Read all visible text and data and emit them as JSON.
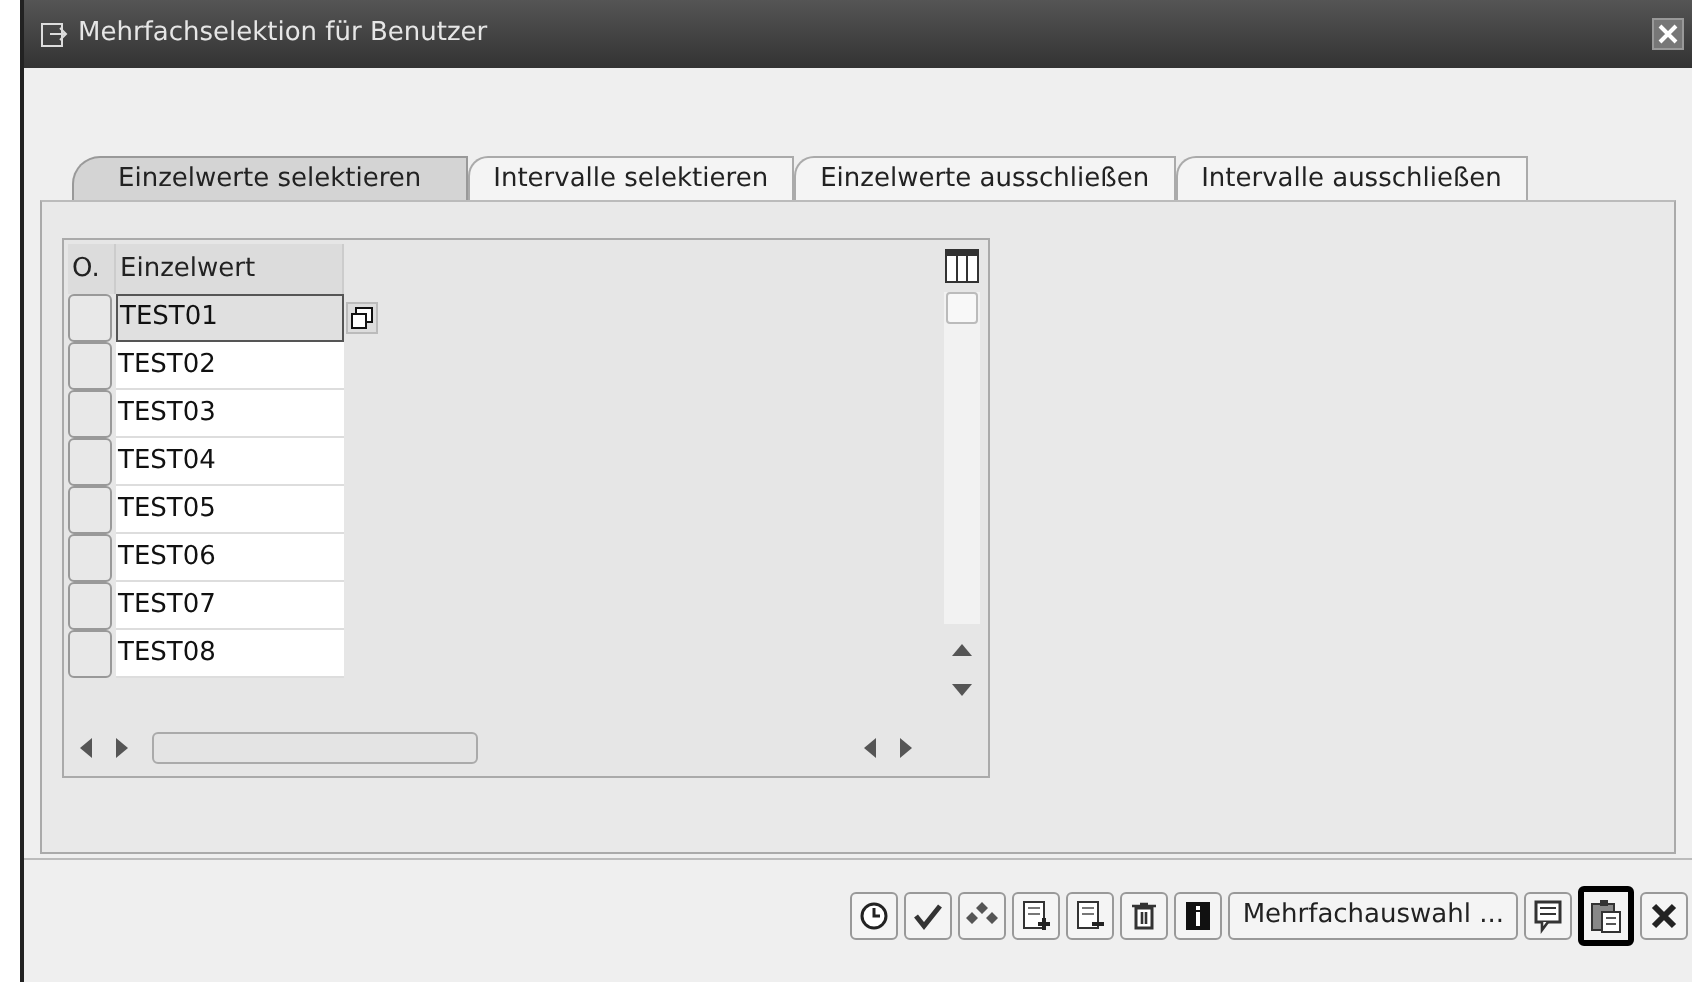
{
  "window": {
    "title": "Mehrfachselektion für Benutzer"
  },
  "tabs": [
    {
      "label": "Einzelwerte selektieren",
      "selected": true
    },
    {
      "label": "Intervalle selektieren",
      "selected": false
    },
    {
      "label": "Einzelwerte ausschließen",
      "selected": false
    },
    {
      "label": "Intervalle ausschließen",
      "selected": false
    }
  ],
  "table": {
    "columns": [
      "O.",
      "Einzelwert"
    ],
    "rows": [
      {
        "value": "TEST01",
        "focused": true
      },
      {
        "value": "TEST02",
        "focused": false
      },
      {
        "value": "TEST03",
        "focused": false
      },
      {
        "value": "TEST04",
        "focused": false
      },
      {
        "value": "TEST05",
        "focused": false
      },
      {
        "value": "TEST06",
        "focused": false
      },
      {
        "value": "TEST07",
        "focused": false
      },
      {
        "value": "TEST08",
        "focused": false
      }
    ]
  },
  "toolbar": [
    {
      "kind": "icon",
      "selected": false
    },
    {
      "kind": "icon",
      "selected": false
    },
    {
      "kind": "icon",
      "selected": false
    },
    {
      "kind": "icon",
      "selected": false
    },
    {
      "kind": "icon",
      "selected": false
    },
    {
      "kind": "icon",
      "selected": false
    },
    {
      "kind": "icon",
      "selected": false
    },
    {
      "kind": "text",
      "label": "Mehrfachauswahl ...",
      "selected": false
    },
    {
      "kind": "icon",
      "selected": false
    },
    {
      "kind": "icon",
      "selected": true
    },
    {
      "kind": "icon",
      "selected": false
    }
  ]
}
